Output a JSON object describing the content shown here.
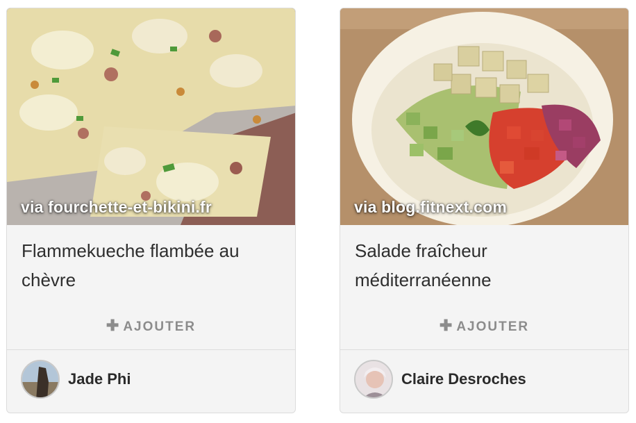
{
  "cards": [
    {
      "source": "via fourchette-et-bikini.fr",
      "title": "Flammekueche flambée au chèvre",
      "add_icon": "plus-icon",
      "add_label": "AJOUTER",
      "author": "Jade Phi"
    },
    {
      "source": "via blog.fitnext.com",
      "title": "Salade fraîcheur méditerranéenne",
      "add_icon": "plus-icon",
      "add_label": "AJOUTER",
      "author": "Claire Desroches"
    }
  ]
}
